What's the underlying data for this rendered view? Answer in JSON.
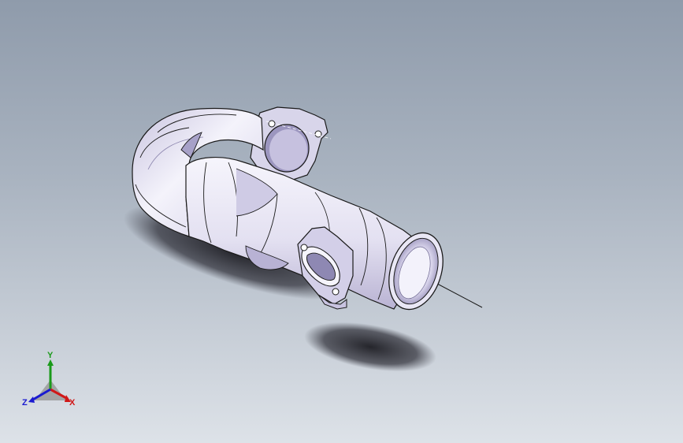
{
  "viewport": {
    "background_top": "#8f9bab",
    "background_bottom": "#dde2e8",
    "model": {
      "description_icon": "exhaust-pipe-model",
      "body_color": "#eceaf7",
      "shade_color": "#bdb8d6",
      "edge_color": "#1a1a1a"
    }
  },
  "triad": {
    "x_label": "X",
    "y_label": "Y",
    "z_label": "Z",
    "x_color": "#d01818",
    "y_color": "#1a9a1a",
    "z_color": "#1a1ad0"
  }
}
